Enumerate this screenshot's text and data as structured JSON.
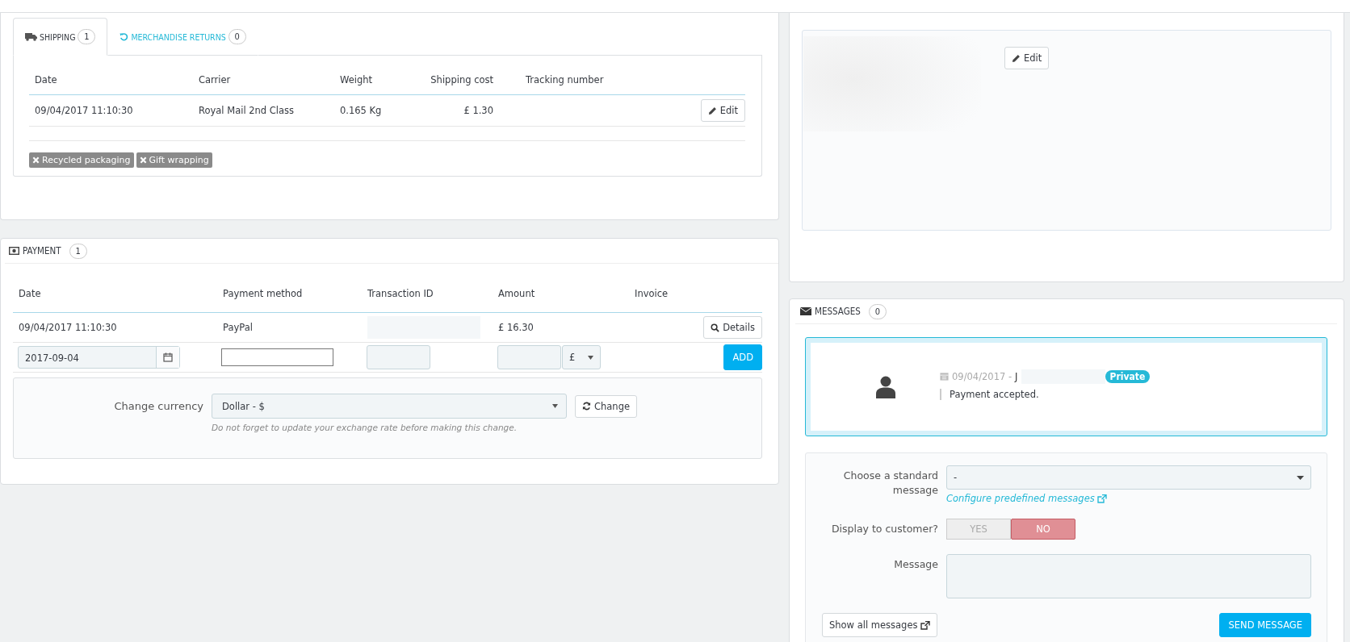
{
  "shipping": {
    "tabs": [
      {
        "label": "SHIPPING",
        "count": "1",
        "selected": true,
        "kind": "truck"
      },
      {
        "label": "MERCHANDISE RETURNS",
        "count": "0",
        "selected": false,
        "kind": "undo"
      }
    ],
    "columns": [
      "Date",
      "Carrier",
      "Weight",
      "Shipping cost",
      "Tracking number"
    ],
    "rows": [
      {
        "date": "09/04/2017 11:10:30",
        "carrier": "Royal Mail 2nd Class",
        "weight": "0.165 Kg",
        "cost": "£ 1.30",
        "button": "Edit"
      }
    ],
    "options": [
      {
        "label": "Recycled packaging",
        "checked": false
      },
      {
        "label": "Gift wrapping",
        "checked": false
      }
    ]
  },
  "address": {
    "edit_button": "Edit"
  },
  "payment": {
    "title": "PAYMENT",
    "count": "1",
    "columns": [
      "Date",
      "Payment method",
      "Transaction ID",
      "Amount",
      "Invoice"
    ],
    "rows": [
      {
        "date": "09/04/2017 11:10:30",
        "method": "PayPal",
        "amount": "£ 16.30",
        "button": "Details"
      }
    ],
    "new_payment": {
      "date": "2017-09-04",
      "currency": "£",
      "add_button": "ADD"
    },
    "change_currency": {
      "label": "Change currency",
      "value": "Dollar - $",
      "button": "Change",
      "hint": "Do not forget to update your exchange rate before making this change."
    }
  },
  "messages": {
    "title": "MESSAGES",
    "count": "0",
    "items": [
      {
        "date": "09/04/2017 -",
        "author": "J",
        "tag": "Private",
        "text": "Payment accepted."
      }
    ],
    "form": {
      "standard_label": "Choose a standard message",
      "standard_value": "-",
      "configure_link": "Configure predefined messages",
      "display_label": "Display to customer?",
      "display_options": [
        {
          "label": "YES",
          "selected": false
        },
        {
          "label": "NO",
          "selected": true
        }
      ],
      "message_label": "Message",
      "show_all": "Show all messages",
      "send": "SEND MESSAGE"
    }
  }
}
